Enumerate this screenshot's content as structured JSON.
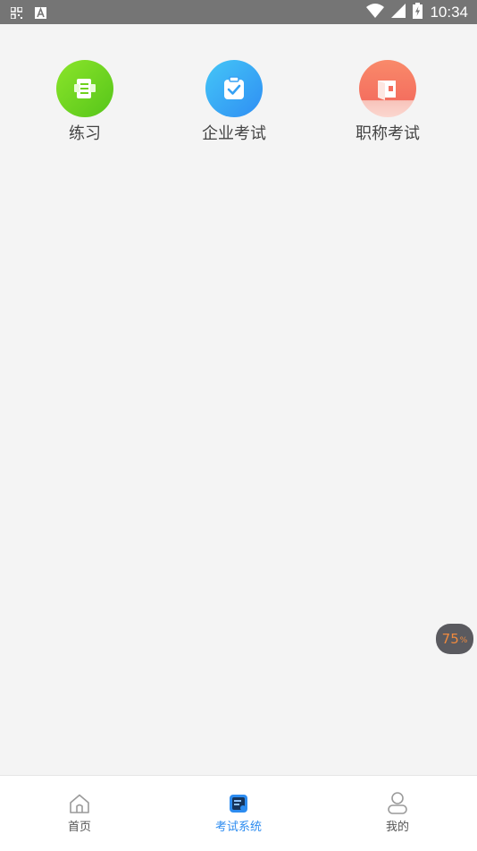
{
  "status_bar": {
    "time": "10:34",
    "icons": [
      "qr-icon",
      "a-icon",
      "wifi-icon",
      "signal-icon",
      "battery-icon"
    ]
  },
  "features": [
    {
      "label": "练习",
      "icon": "practice-book-icon",
      "color": "#6fd21c"
    },
    {
      "label": "企业考试",
      "icon": "clipboard-check-icon",
      "color": "#33a9f4"
    },
    {
      "label": "职称考试",
      "icon": "wallet-icon",
      "color": "#f67a62"
    }
  ],
  "floating_badge": {
    "value": "75",
    "unit": "%"
  },
  "tabbar": {
    "tabs": [
      {
        "label": "首页",
        "icon": "home-icon",
        "active": false
      },
      {
        "label": "考试系统",
        "icon": "exam-icon",
        "active": true
      },
      {
        "label": "我的",
        "icon": "user-icon",
        "active": false
      }
    ],
    "active_color": "#2d8cf0"
  }
}
